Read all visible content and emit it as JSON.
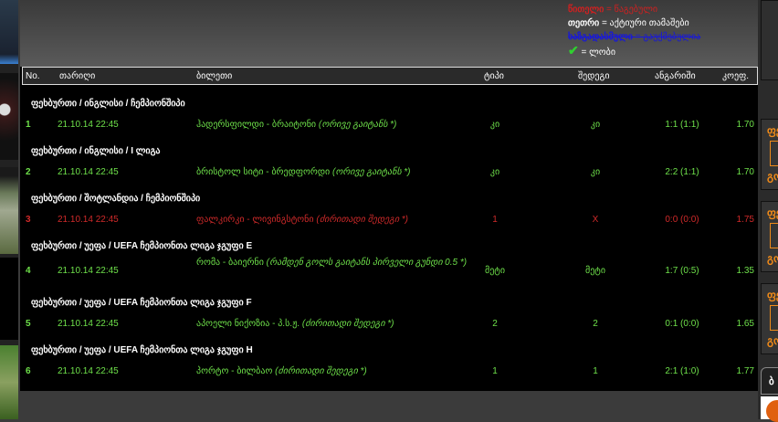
{
  "legend": {
    "red_key": "წითელი",
    "red_val": "= წაგებული",
    "white_key": "თეთრი",
    "white_val": "= აქტიური თამაშები",
    "struck_key": "ხაზგადასმული",
    "struck_val": "= გაუქმებულია",
    "check_icon": "checkmark",
    "check_val": "= ლობი"
  },
  "columns": {
    "no": "No.",
    "date": "თარიღი",
    "ticket": "ბილეთი",
    "type": "ტიპი",
    "result": "შედეგი",
    "score": "ანგარიში",
    "odds": "კოეფ."
  },
  "groups": [
    {
      "title": "ფეხბურთი / ინგლისი / ჩემპიონშიპი",
      "no": "1",
      "date": "21.10.14 22:45",
      "match": "ჰადერსფილდი - ბრაიტონი",
      "bet": "(ორივე გაიტანს *)",
      "type": "კი",
      "result": "კი",
      "score": "1:1 (1:1)",
      "odds": "1.70",
      "status": "green"
    },
    {
      "title": "ფეხბურთი / ინგლისი / I ლიგა",
      "no": "2",
      "date": "21.10.14 22:45",
      "match": "ბრისტოლ სიტი - ბრედფორდი",
      "bet": "(ორივე გაიტანს *)",
      "type": "კი",
      "result": "კი",
      "score": "2:2 (1:1)",
      "odds": "1.70",
      "status": "green"
    },
    {
      "title": "ფეხბურთი / შოტლანდია / ჩემპიონშიპი",
      "no": "3",
      "date": "21.10.14 22:45",
      "match": "ფალკირკი - ლივინგსტონი",
      "bet": "(ძირითადი შედეგი *)",
      "type": "1",
      "result": "X",
      "score": "0:0 (0:0)",
      "odds": "1.75",
      "status": "red"
    },
    {
      "title": "ფეხბურთი / უეფა / UEFA ჩემპიონთა ლიგა ჯგუფი E",
      "no": "4",
      "date": "21.10.14 22:45",
      "match": "რომა - ბაიერნი",
      "bet": "(რამდენ გოლს გაიტანს პირველი გუნდი 0.5 *)",
      "type": "მეტი",
      "result": "მეტი",
      "score": "1:7 (0:5)",
      "odds": "1.35",
      "status": "green"
    },
    {
      "title": "ფეხბურთი / უეფა / UEFA ჩემპიონთა ლიგა ჯგუფი F",
      "no": "5",
      "date": "21.10.14 22:45",
      "match": "აპოელი ნიქოზია - პ.ს.ჟ.",
      "bet": "(ძირითადი შედეგი *)",
      "type": "2",
      "result": "2",
      "score": "0:1 (0:0)",
      "odds": "1.65",
      "status": "green"
    },
    {
      "title": "ფეხბურთი / უეფა / UEFA ჩემპიონთა ლიგა ჯგუფი H",
      "no": "6",
      "date": "21.10.14 22:45",
      "match": "პორტო - ბილბაო",
      "bet": "(ძირითადი შედეგი *)",
      "type": "1",
      "result": "1",
      "score": "2:1 (1:0)",
      "odds": "1.77",
      "status": "green"
    }
  ],
  "right_panels": {
    "p1": "ფე",
    "p2": "გო",
    "tab": "ბ"
  }
}
